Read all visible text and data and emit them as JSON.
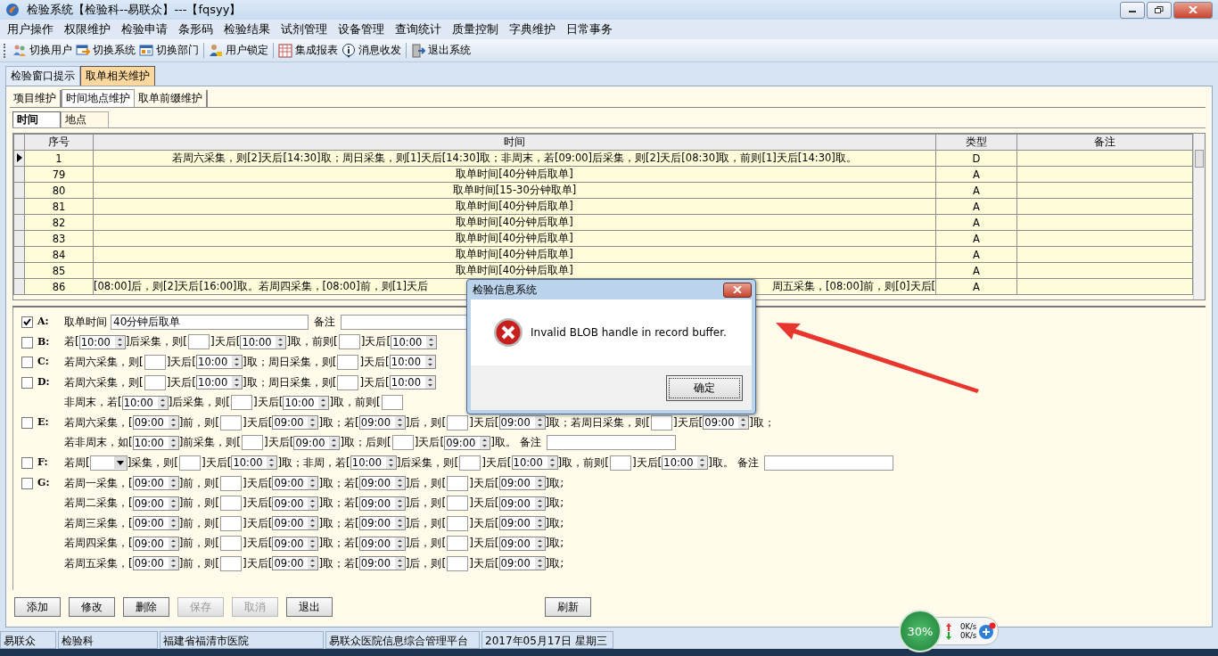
{
  "window": {
    "title": "检验系统【检验科--易联众】---【fqsyy】"
  },
  "menu": [
    "用户操作",
    "权限维护",
    "检验申请",
    "条形码",
    "检验结果",
    "试剂管理",
    "设备管理",
    "查询统计",
    "质量控制",
    "字典维护",
    "日常事务"
  ],
  "toolbar": [
    [
      "切换用户",
      "切换系统",
      "切换部门"
    ],
    [
      "用户锁定"
    ],
    [
      "集成报表",
      "消息收发"
    ],
    [
      "退出系统"
    ]
  ],
  "main_tabs": [
    {
      "label": "检验窗口提示",
      "selected": false
    },
    {
      "label": "取单相关维护",
      "selected": true
    }
  ],
  "sub_tabs": [
    {
      "label": "项目维护",
      "selected": false
    },
    {
      "label": "时间地点维护",
      "selected": true
    },
    {
      "label": "取单前缀维护",
      "selected": false
    }
  ],
  "inner_tabs": [
    {
      "label": "时间",
      "selected": true
    },
    {
      "label": "地点",
      "selected": false
    }
  ],
  "grid": {
    "columns": [
      "序号",
      "时间",
      "类型",
      "备注"
    ],
    "rows": [
      {
        "seq": "1",
        "time": "若周六采集，则[2]天后[14:30]取；周日采集，则[1]天后[14:30]取；非周末，若[09:00]后采集，则[2]天后[08:30]取，前则[1]天后[14:30]取。",
        "type": "D",
        "selected": true
      },
      {
        "seq": "79",
        "time": "取单时间[40分钟后取单]",
        "type": "A",
        "selected": false
      },
      {
        "seq": "80",
        "time": "取单时间[15-30分钟取单]",
        "type": "A",
        "selected": false
      },
      {
        "seq": "81",
        "time": "取单时间[40分钟后取单]",
        "type": "A",
        "selected": false
      },
      {
        "seq": "82",
        "time": "取单时间[40分钟后取单]",
        "type": "A",
        "selected": false
      },
      {
        "seq": "83",
        "time": "取单时间[40分钟后取单]",
        "type": "A",
        "selected": false
      },
      {
        "seq": "84",
        "time": "取单时间[40分钟后取单]",
        "type": "A",
        "selected": false
      },
      {
        "seq": "85",
        "time": "取单时间[40分钟后取单]",
        "type": "A",
        "selected": false
      },
      {
        "seq": "86",
        "time": "[08:00]后，则[2]天后[16:00]取。若周四采集，[08:00]前，则[1]天后",
        "time_tail": "周五采集，[08:00]前，则[0]天后[",
        "type": "A",
        "selected": false
      }
    ]
  },
  "form": {
    "rows": [
      {
        "letter": "A:",
        "checked": true,
        "lines": [
          [
            {
              "kind": "text",
              "text": "取单时间"
            },
            {
              "kind": "input",
              "value": "40分钟后取单"
            },
            {
              "kind": "text",
              "text": "备注"
            },
            {
              "kind": "note"
            }
          ]
        ]
      },
      {
        "letter": "B:",
        "checked": false,
        "lines": [
          [
            {
              "kind": "text",
              "text": "若["
            },
            {
              "kind": "spin",
              "value": "10:00"
            },
            {
              "kind": "text",
              "text": "]后采集，则["
            },
            {
              "kind": "field"
            },
            {
              "kind": "text",
              "text": "]天后["
            },
            {
              "kind": "spin",
              "value": "10:00"
            },
            {
              "kind": "text",
              "text": "]取，前则["
            },
            {
              "kind": "field"
            },
            {
              "kind": "text",
              "text": "]天后["
            },
            {
              "kind": "spin",
              "value": "10:00"
            }
          ]
        ]
      },
      {
        "letter": "C:",
        "checked": false,
        "lines": [
          [
            {
              "kind": "text",
              "text": "若周六采集，则["
            },
            {
              "kind": "field"
            },
            {
              "kind": "text",
              "text": "]天后["
            },
            {
              "kind": "spin",
              "value": "10:00"
            },
            {
              "kind": "text",
              "text": "]取；周日采集，则["
            },
            {
              "kind": "field"
            },
            {
              "kind": "text",
              "text": "]天后["
            },
            {
              "kind": "spin",
              "value": "10:00"
            }
          ]
        ]
      },
      {
        "letter": "D:",
        "checked": false,
        "lines": [
          [
            {
              "kind": "text",
              "text": "若周六采集，则["
            },
            {
              "kind": "field"
            },
            {
              "kind": "text",
              "text": "]天后["
            },
            {
              "kind": "spin",
              "value": "10:00"
            },
            {
              "kind": "text",
              "text": "]取；周日采集，则["
            },
            {
              "kind": "field"
            },
            {
              "kind": "text",
              "text": "]天后["
            },
            {
              "kind": "spin",
              "value": "10:00"
            }
          ],
          [
            {
              "kind": "text",
              "text": "非周末，若["
            },
            {
              "kind": "spin",
              "value": "10:00"
            },
            {
              "kind": "text",
              "text": "]后采集，则["
            },
            {
              "kind": "field"
            },
            {
              "kind": "text",
              "text": "]天后["
            },
            {
              "kind": "spin",
              "value": "10:00"
            },
            {
              "kind": "text",
              "text": "]取，前则["
            },
            {
              "kind": "field"
            }
          ]
        ]
      },
      {
        "letter": "E:",
        "checked": false,
        "lines": [
          [
            {
              "kind": "text",
              "text": "若周六采集，["
            },
            {
              "kind": "spin",
              "value": "09:00"
            },
            {
              "kind": "text",
              "text": "]前，则["
            },
            {
              "kind": "field"
            },
            {
              "kind": "text",
              "text": "]天后["
            },
            {
              "kind": "spin",
              "value": "09:00"
            },
            {
              "kind": "text",
              "text": "]取；若["
            },
            {
              "kind": "spin",
              "value": "09:00"
            },
            {
              "kind": "text",
              "text": "]后，则["
            },
            {
              "kind": "field"
            },
            {
              "kind": "text",
              "text": "]天后["
            },
            {
              "kind": "spin",
              "value": "09:00"
            },
            {
              "kind": "text",
              "text": "]取；若周日采集，则["
            },
            {
              "kind": "field"
            },
            {
              "kind": "text",
              "text": "]天后["
            },
            {
              "kind": "spin",
              "value": "09:00"
            },
            {
              "kind": "text",
              "text": "]取；"
            }
          ],
          [
            {
              "kind": "text",
              "text": "若非周末，如["
            },
            {
              "kind": "spin",
              "value": "10:00"
            },
            {
              "kind": "text",
              "text": "]前采集，则["
            },
            {
              "kind": "field"
            },
            {
              "kind": "text",
              "text": "]天后["
            },
            {
              "kind": "spin",
              "value": "09:00"
            },
            {
              "kind": "text",
              "text": "]取；后则["
            },
            {
              "kind": "field"
            },
            {
              "kind": "text",
              "text": "]天后["
            },
            {
              "kind": "spin",
              "value": "09:00"
            },
            {
              "kind": "text",
              "text": "]取。 备注"
            },
            {
              "kind": "note"
            }
          ]
        ]
      },
      {
        "letter": "F:",
        "checked": false,
        "lines": [
          [
            {
              "kind": "text",
              "text": "若周["
            },
            {
              "kind": "combo"
            },
            {
              "kind": "text",
              "text": "]采集，则["
            },
            {
              "kind": "field"
            },
            {
              "kind": "text",
              "text": "]天后["
            },
            {
              "kind": "spin",
              "value": "10:00"
            },
            {
              "kind": "text",
              "text": "]取；非周，若["
            },
            {
              "kind": "spin",
              "value": "10:00"
            },
            {
              "kind": "text",
              "text": "]后采集，则["
            },
            {
              "kind": "field"
            },
            {
              "kind": "text",
              "text": "]天后["
            },
            {
              "kind": "spin",
              "value": "10:00"
            },
            {
              "kind": "text",
              "text": "]取，前则["
            },
            {
              "kind": "field"
            },
            {
              "kind": "text",
              "text": "]天后["
            },
            {
              "kind": "spin",
              "value": "10:00"
            },
            {
              "kind": "text",
              "text": "]取。 备注"
            },
            {
              "kind": "note"
            }
          ]
        ]
      },
      {
        "letter": "G:",
        "checked": false,
        "lines": [
          [
            {
              "kind": "text",
              "text": "若周一采集，["
            },
            {
              "kind": "spin",
              "value": "09:00"
            },
            {
              "kind": "text",
              "text": "]前，则["
            },
            {
              "kind": "field"
            },
            {
              "kind": "text",
              "text": "]天后["
            },
            {
              "kind": "spin",
              "value": "09:00"
            },
            {
              "kind": "text",
              "text": "]取；若["
            },
            {
              "kind": "spin",
              "value": "09:00"
            },
            {
              "kind": "text",
              "text": "]后，则["
            },
            {
              "kind": "field"
            },
            {
              "kind": "text",
              "text": "]天后["
            },
            {
              "kind": "spin",
              "value": "09:00"
            },
            {
              "kind": "text",
              "text": "]取;"
            }
          ],
          [
            {
              "kind": "text",
              "text": "若周二采集，["
            },
            {
              "kind": "spin",
              "value": "09:00"
            },
            {
              "kind": "text",
              "text": "]前，则["
            },
            {
              "kind": "field"
            },
            {
              "kind": "text",
              "text": "]天后["
            },
            {
              "kind": "spin",
              "value": "09:00"
            },
            {
              "kind": "text",
              "text": "]取；若["
            },
            {
              "kind": "spin",
              "value": "09:00"
            },
            {
              "kind": "text",
              "text": "]后，则["
            },
            {
              "kind": "field"
            },
            {
              "kind": "text",
              "text": "]天后["
            },
            {
              "kind": "spin",
              "value": "09:00"
            },
            {
              "kind": "text",
              "text": "]取;"
            }
          ],
          [
            {
              "kind": "text",
              "text": "若周三采集，["
            },
            {
              "kind": "spin",
              "value": "09:00"
            },
            {
              "kind": "text",
              "text": "]前，则["
            },
            {
              "kind": "field"
            },
            {
              "kind": "text",
              "text": "]天后["
            },
            {
              "kind": "spin",
              "value": "09:00"
            },
            {
              "kind": "text",
              "text": "]取；若["
            },
            {
              "kind": "spin",
              "value": "09:00"
            },
            {
              "kind": "text",
              "text": "]后，则["
            },
            {
              "kind": "field"
            },
            {
              "kind": "text",
              "text": "]天后["
            },
            {
              "kind": "spin",
              "value": "09:00"
            },
            {
              "kind": "text",
              "text": "]取;"
            }
          ],
          [
            {
              "kind": "text",
              "text": "若周四采集，["
            },
            {
              "kind": "spin",
              "value": "09:00"
            },
            {
              "kind": "text",
              "text": "]前，则["
            },
            {
              "kind": "field"
            },
            {
              "kind": "text",
              "text": "]天后["
            },
            {
              "kind": "spin",
              "value": "09:00"
            },
            {
              "kind": "text",
              "text": "]取；若["
            },
            {
              "kind": "spin",
              "value": "09:00"
            },
            {
              "kind": "text",
              "text": "]后，则["
            },
            {
              "kind": "field"
            },
            {
              "kind": "text",
              "text": "]天后["
            },
            {
              "kind": "spin",
              "value": "09:00"
            },
            {
              "kind": "text",
              "text": "]取;"
            }
          ],
          [
            {
              "kind": "text",
              "text": "若周五采集，["
            },
            {
              "kind": "spin",
              "value": "09:00"
            },
            {
              "kind": "text",
              "text": "]前，则["
            },
            {
              "kind": "field"
            },
            {
              "kind": "text",
              "text": "]天后["
            },
            {
              "kind": "spin",
              "value": "09:00"
            },
            {
              "kind": "text",
              "text": "]取；若["
            },
            {
              "kind": "spin",
              "value": "09:00"
            },
            {
              "kind": "text",
              "text": "]后，则["
            },
            {
              "kind": "field"
            },
            {
              "kind": "text",
              "text": "]天后["
            },
            {
              "kind": "spin",
              "value": "09:00"
            },
            {
              "kind": "text",
              "text": "]取;"
            }
          ]
        ]
      }
    ]
  },
  "buttons": [
    [
      {
        "label": "添加",
        "disabled": false
      },
      {
        "label": "修改",
        "disabled": false
      },
      {
        "label": "删除",
        "disabled": false
      },
      {
        "label": "保存",
        "disabled": true
      },
      {
        "label": "取消",
        "disabled": true
      },
      {
        "label": "退出",
        "disabled": false
      }
    ],
    [
      {
        "label": "刷新",
        "disabled": false
      }
    ]
  ],
  "status_bar": [
    "易联众",
    "检验科",
    "福建省福清市医院",
    "易联众医院信息综合管理平台",
    "2017年05月17日 星期三"
  ],
  "network_widget": {
    "percent": "30%",
    "upload": "0K/s",
    "download": "0K/s"
  },
  "dialog": {
    "title": "检验信息系统",
    "message": "Invalid BLOB handle in record buffer.",
    "button": "确定"
  }
}
